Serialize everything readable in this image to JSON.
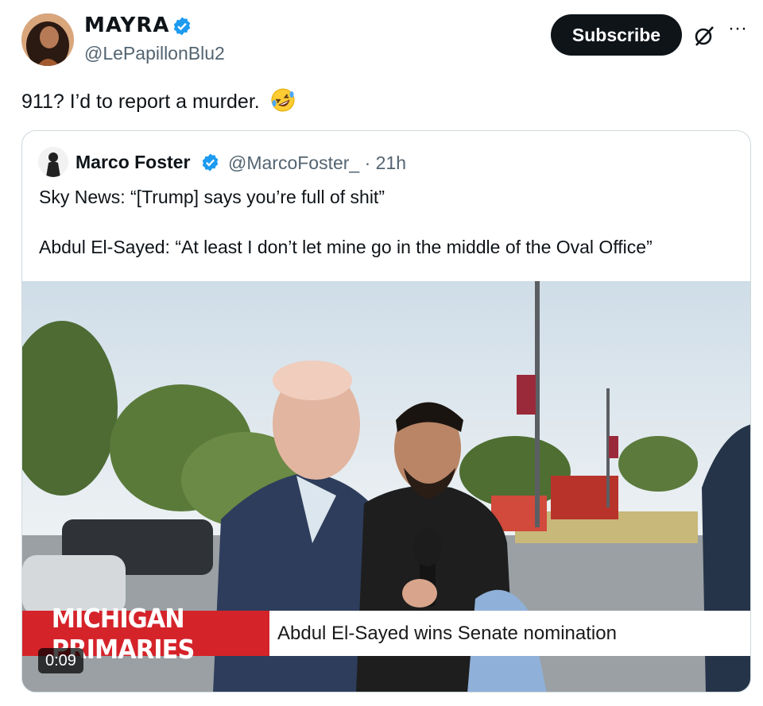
{
  "author": {
    "display_name": "MAYRA",
    "handle": "@LePapillonBlu2"
  },
  "actions": {
    "subscribe_label": "Subscribe",
    "more_label": "···"
  },
  "post": {
    "text": "911? I’d to report a murder."
  },
  "quoted_post": {
    "display_name": "Marco Foster",
    "handle_time": "@MarcoFoster_ · 21h",
    "line1": "Sky News: “[Trump] says you’re full of shit”",
    "line2": "Abdul El-Sayed: “At least I don’t let mine go in the middle of the Oval Office”"
  },
  "video": {
    "lower_third_title": "MICHIGAN PRIMARIES",
    "lower_third_caption": "Abdul El-Sayed wins Senate nomination",
    "timestamp": "0:09"
  },
  "colors": {
    "verified": "#1d9bf0",
    "brand_red": "#d5232a",
    "text_secondary": "#536471"
  }
}
